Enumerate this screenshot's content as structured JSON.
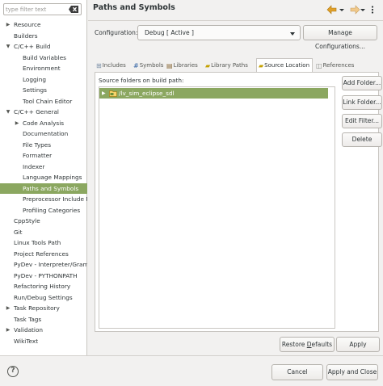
{
  "filter": {
    "placeholder": "type filter text",
    "clear_icon": "clear-filter-icon"
  },
  "tree": [
    {
      "label": "Resource",
      "expander": "▶",
      "level": 0
    },
    {
      "label": "Builders",
      "expander": "",
      "level": 0
    },
    {
      "label": "C/C++ Build",
      "expander": "▼",
      "level": 0
    },
    {
      "label": "Build Variables",
      "expander": "",
      "level": 1
    },
    {
      "label": "Environment",
      "expander": "",
      "level": 1
    },
    {
      "label": "Logging",
      "expander": "",
      "level": 1
    },
    {
      "label": "Settings",
      "expander": "",
      "level": 1
    },
    {
      "label": "Tool Chain Editor",
      "expander": "",
      "level": 1
    },
    {
      "label": "C/C++ General",
      "expander": "▼",
      "level": 0
    },
    {
      "label": "Code Analysis",
      "expander": "▶",
      "level": 1
    },
    {
      "label": "Documentation",
      "expander": "",
      "level": 1
    },
    {
      "label": "File Types",
      "expander": "",
      "level": 1
    },
    {
      "label": "Formatter",
      "expander": "",
      "level": 1
    },
    {
      "label": "Indexer",
      "expander": "",
      "level": 1
    },
    {
      "label": "Language Mappings",
      "expander": "",
      "level": 1
    },
    {
      "label": "Paths and Symbols",
      "expander": "",
      "level": 1,
      "selected": true
    },
    {
      "label": "Preprocessor Include P",
      "expander": "",
      "level": 1
    },
    {
      "label": "Profiling Categories",
      "expander": "",
      "level": 1
    },
    {
      "label": "CppStyle",
      "expander": "",
      "level": 0
    },
    {
      "label": "Git",
      "expander": "",
      "level": 0
    },
    {
      "label": "Linux Tools Path",
      "expander": "",
      "level": 0
    },
    {
      "label": "Project References",
      "expander": "",
      "level": 0
    },
    {
      "label": "PyDev - Interpreter/Gram",
      "expander": "",
      "level": 0
    },
    {
      "label": "PyDev - PYTHONPATH",
      "expander": "",
      "level": 0
    },
    {
      "label": "Refactoring History",
      "expander": "",
      "level": 0
    },
    {
      "label": "Run/Debug Settings",
      "expander": "",
      "level": 0
    },
    {
      "label": "Task Repository",
      "expander": "▶",
      "level": 0
    },
    {
      "label": "Task Tags",
      "expander": "",
      "level": 0
    },
    {
      "label": "Validation",
      "expander": "▶",
      "level": 0
    },
    {
      "label": "WikiText",
      "expander": "",
      "level": 0
    }
  ],
  "header": {
    "title": "Paths and Symbols",
    "back_icon": "back-arrow-icon",
    "forward_icon": "forward-arrow-icon",
    "menu_icon": "view-menu-icon",
    "colors": {
      "arrow_active": "#e0a02a",
      "arrow_inactive": "#f1c98a"
    }
  },
  "config": {
    "label": "Configuration:",
    "value": "Debug  [ Active ]",
    "manage_label": "Manage Configurations..."
  },
  "tabs": [
    {
      "label": "Includes",
      "icon": "includes-icon",
      "icon_char": "⊞",
      "color": "#7a8fa6"
    },
    {
      "label": "Symbols",
      "icon": "symbols-icon",
      "icon_char": "#",
      "color": "#3465a4"
    },
    {
      "label": "Libraries",
      "icon": "libraries-icon",
      "icon_char": "▤",
      "color": "#8a6a3a"
    },
    {
      "label": "Library Paths",
      "icon": "library-paths-icon",
      "icon_char": "▰",
      "color": "#c4a000"
    },
    {
      "label": "Source Location",
      "icon": "source-location-icon",
      "icon_char": "▰",
      "color": "#c4a000",
      "active": true
    },
    {
      "label": "References",
      "icon": "references-icon",
      "icon_char": "◫",
      "color": "#888a85"
    }
  ],
  "source": {
    "label": "Source folders on build path:",
    "folders": [
      {
        "name": "/lv_sim_eclipse_sdl",
        "expander": "▶",
        "icon": "source-folder-icon"
      }
    ]
  },
  "side_buttons": {
    "add": "Add Folder...",
    "link": "Link Folder...",
    "edit": "Edit Filter...",
    "delete": "Delete"
  },
  "footer": {
    "restore_pre": "Restore ",
    "restore_u": "D",
    "restore_post": "efaults",
    "apply": "Apply",
    "cancel": "Cancel",
    "apply_close": "Apply and Close",
    "help_icon": "help-icon",
    "help_glyph": "?"
  },
  "colors": {
    "selection": "#8ba760",
    "window_bg": "#f2f1f0",
    "text": "#2e3436"
  }
}
